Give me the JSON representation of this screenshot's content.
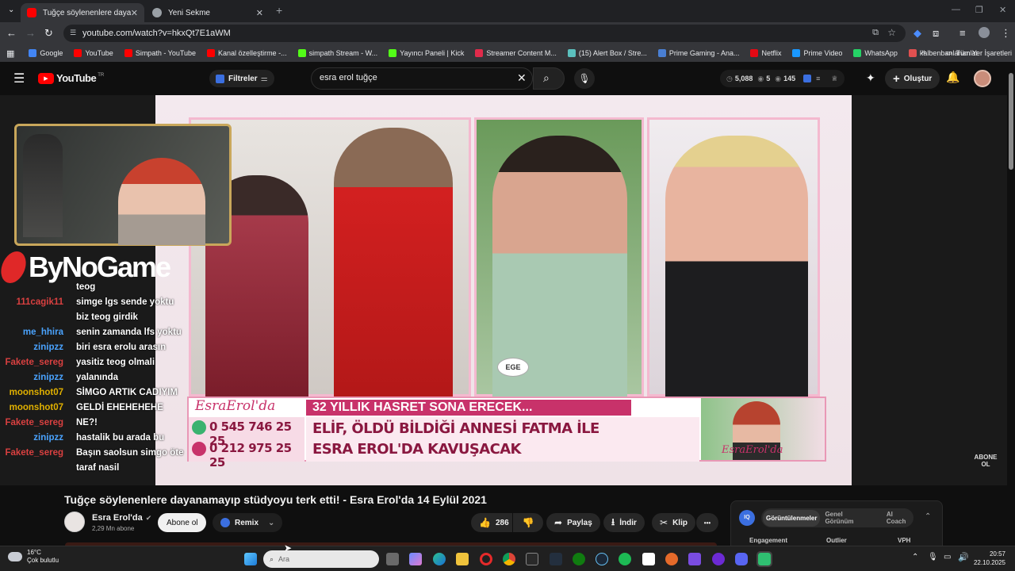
{
  "browser": {
    "tabs": [
      {
        "label": "Tuğçe söylenenlere dayanamayıp",
        "active": true
      },
      {
        "label": "Yeni Sekme",
        "active": false
      }
    ],
    "new_tab": "+",
    "url": "youtube.com/watch?v=hkxQt7E1aWM",
    "bookmarks": [
      {
        "label": "Google",
        "color": "#4285f4"
      },
      {
        "label": "YouTube",
        "color": "#ff0000"
      },
      {
        "label": "Simpath - YouTube",
        "color": "#ff0000"
      },
      {
        "label": "Kanal özelleştirme -...",
        "color": "#ff0000"
      },
      {
        "label": "simpath Stream - W...",
        "color": "#53fc18"
      },
      {
        "label": "Yayıncı Paneli | Kick",
        "color": "#53fc18"
      },
      {
        "label": "Streamer Content M...",
        "color": "#e02b4b"
      },
      {
        "label": "(15) Alert Box / Stre...",
        "color": "#5bc0be"
      },
      {
        "label": "Prime Gaming - Ana...",
        "color": "#4a7fd3"
      },
      {
        "label": "Netflix",
        "color": "#e50914"
      },
      {
        "label": "Prime Video",
        "color": "#1a98ff"
      },
      {
        "label": "WhatsApp",
        "color": "#25d366"
      },
      {
        "label": "kalbenbanlananlar",
        "color": "#e05050"
      }
    ],
    "all_bookmarks": "Tüm Yer İşaretleri"
  },
  "youtube": {
    "logo": "YouTube",
    "logo_suffix": "TR",
    "filters_label": "Filtreler",
    "search_value": "esra erol tuğçe",
    "stats": {
      "views": "5,088",
      "s2": "5",
      "s3": "145"
    },
    "create_label": "Oluştur"
  },
  "video": {
    "overlay_brand": "ByNoGame",
    "banner_brand": "EsraErol'da",
    "phone1": "0 545 746 25 25",
    "phone2": "0 212 975 25 25",
    "headline1": "32 YILLIK HASRET SONA ERECEK...",
    "headline2": "ELİF, ÖLDÜ BİLDİĞİ ANNESİ FATMA İLE",
    "headline3": "ESRA EROL'DA KAVUŞACAK",
    "badge_name": "EGE",
    "subscribe_watermark": "ABONE OL",
    "chat": [
      {
        "user": "",
        "msg": "teog",
        "color": "#d94040"
      },
      {
        "user": "111cagik11",
        "msg": "simge lgs sende yoktu",
        "color": "#d94040"
      },
      {
        "user": "",
        "msg": "biz teog girdik",
        "color": "#ffffff"
      },
      {
        "user": "me_hhira",
        "msg": "senin zamanda lfs yoktu",
        "color": "#4aa3ff"
      },
      {
        "user": "zinipzz",
        "msg": "biri esra erolu arasın",
        "color": "#4aa3ff"
      },
      {
        "user": "Fakete_sereg",
        "msg": "yasitiz teog olmali",
        "color": "#d94040"
      },
      {
        "user": "zinipzz",
        "msg": "yalanında",
        "color": "#4aa3ff"
      },
      {
        "user": "moonshot07",
        "msg": "SİMGO ARTIK CADIYIM",
        "color": "#e0b000"
      },
      {
        "user": "moonshot07",
        "msg": "GELDİ EHEHEHEHE",
        "color": "#e0b000"
      },
      {
        "user": "Fakete_sereg",
        "msg": "NE?!",
        "color": "#d94040"
      },
      {
        "user": "zinipzz",
        "msg": "hastalik bu arada bu",
        "color": "#4aa3ff"
      },
      {
        "user": "Fakete_sereg",
        "msg": "Başın saolsun simgo öte",
        "color": "#d94040"
      },
      {
        "user": "",
        "msg": "taraf nasil",
        "color": "#ffffff"
      }
    ]
  },
  "details": {
    "title": "Tuğçe söylenenlere dayanamayıp stüdyoyu terk etti! - Esra Erol'da 14 Eylül 2021",
    "channel": "Esra Erol'da",
    "subscribers": "2,29 Mn abone",
    "subscribe_label": "Abone ol",
    "remix_label": "Remix",
    "likes": "286",
    "share_label": "Paylaş",
    "download_label": "İndir",
    "clip_label": "Klip",
    "more_label": "•••"
  },
  "iq_panel": {
    "tabs": [
      "Görüntülenmeler",
      "Genel Görünüm",
      "AI Coach"
    ],
    "columns": [
      "Engagement",
      "Outlier",
      "VPH"
    ]
  },
  "taskbar": {
    "weather_temp": "16°C",
    "weather_desc": "Çok bulutlu",
    "search_placeholder": "Ara",
    "time": "20:57",
    "date": "22.10.2025"
  }
}
